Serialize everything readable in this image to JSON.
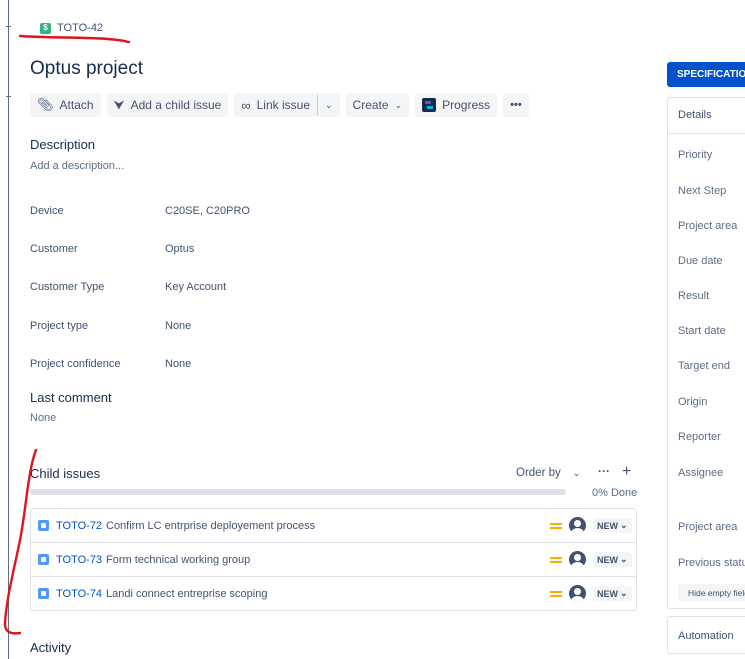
{
  "breadcrumb": {
    "issue_key": "TOTO-42",
    "issue_type_icon": "story-icon"
  },
  "issue": {
    "title": "Optus project"
  },
  "toolbar": {
    "attach": "Attach",
    "add_child": "Add a child issue",
    "link_issue": "Link issue",
    "create": "Create",
    "progress": "Progress",
    "more": "•••"
  },
  "description": {
    "heading": "Description",
    "placeholder": "Add a description..."
  },
  "fields": [
    {
      "label": "Device",
      "value": "C20SE, C20PRO"
    },
    {
      "label": "Customer",
      "value": "Optus"
    },
    {
      "label": "Customer Type",
      "value": "Key Account"
    },
    {
      "label": "Project type",
      "value": "None"
    },
    {
      "label": "Project confidence",
      "value": "None"
    }
  ],
  "last_comment": {
    "heading": "Last comment",
    "value": "None"
  },
  "child_issues": {
    "heading": "Child issues",
    "order_by": "Order by",
    "done_percent": 0,
    "done_label": "0% Done",
    "items": [
      {
        "key": "TOTO-72",
        "summary": "Confirm LC entrprise deployement process",
        "status": "NEW",
        "priority_color": "#ffab00"
      },
      {
        "key": "TOTO-73",
        "summary": "Form technical working group",
        "status": "NEW",
        "priority_color": "#ffab00"
      },
      {
        "key": "TOTO-74",
        "summary": "Landi connect entreprise scoping",
        "status": "NEW",
        "priority_color": "#ffab00"
      }
    ]
  },
  "activity": {
    "heading": "Activity"
  },
  "right_panel": {
    "spec_button": "SPECIFICATION",
    "details_heading": "Details",
    "fields": [
      "Priority",
      "Next Step",
      "Project area",
      "Due date",
      "Result",
      "Start date",
      "Target end",
      "Origin",
      "Reporter",
      "Assignee",
      "Project area",
      "Previous status"
    ],
    "hide_empty": "Hide empty fields",
    "automation": "Automation"
  },
  "colors": {
    "accent": "#0052cc",
    "annotation": "#e0141e"
  }
}
